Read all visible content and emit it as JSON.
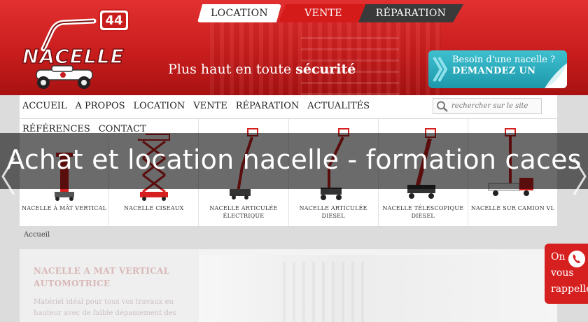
{
  "top_tabs": {
    "location": "LOCATION",
    "vente": "VENTE",
    "reparation": "RÉPARATION"
  },
  "logo": {
    "badge": "44",
    "wordmark": "NACELLE"
  },
  "tagline": {
    "text": "Plus haut en toute ",
    "bold": "sécurité"
  },
  "cta": {
    "line1": "Besoin d'une nacelle ?",
    "line2": "DEMANDEZ UN"
  },
  "nav": {
    "items": [
      "ACCUEIL",
      "A PROPOS",
      "LOCATION",
      "VENTE",
      "RÉPARATION",
      "ACTUALITÉS"
    ],
    "items2": [
      "RÉFÉRENCES",
      "CONTACT"
    ],
    "search_placeholder": "rechercher sur le site"
  },
  "products": [
    {
      "label": "NACELLE À MÂT VERTICAL",
      "icon": "vertical-mast-lift-icon"
    },
    {
      "label": "NACELLE CISEAUX",
      "icon": "scissor-lift-icon"
    },
    {
      "label": "NACELLE ARTICULÉE ÉLECTRIQUE",
      "icon": "electric-boom-lift-icon"
    },
    {
      "label": "NACELLE ARTICULÉE DIESEL",
      "icon": "diesel-boom-lift-icon"
    },
    {
      "label": "NACELLE TÉLESCOPIQUE DIESEL",
      "icon": "telescopic-lift-icon"
    },
    {
      "label": "NACELLE SUR CAMION VL",
      "icon": "truck-mounted-lift-icon"
    }
  ],
  "breadcrumb": "Accueil",
  "content": {
    "title": "NACELLE A MAT VERTICAL AUTOMOTRICE",
    "text": "Matériel idéal pour tous vos travaux en hauteur avec de faible dépassement des"
  },
  "overlay_title": "Achat et location nacelle - formation caces",
  "callback": {
    "line1": "On",
    "line2": "vous",
    "line3": "rappelle"
  },
  "colors": {
    "brand_red": "#c91d1d",
    "cta_teal": "#2aaabd",
    "overlay": "#000000"
  }
}
